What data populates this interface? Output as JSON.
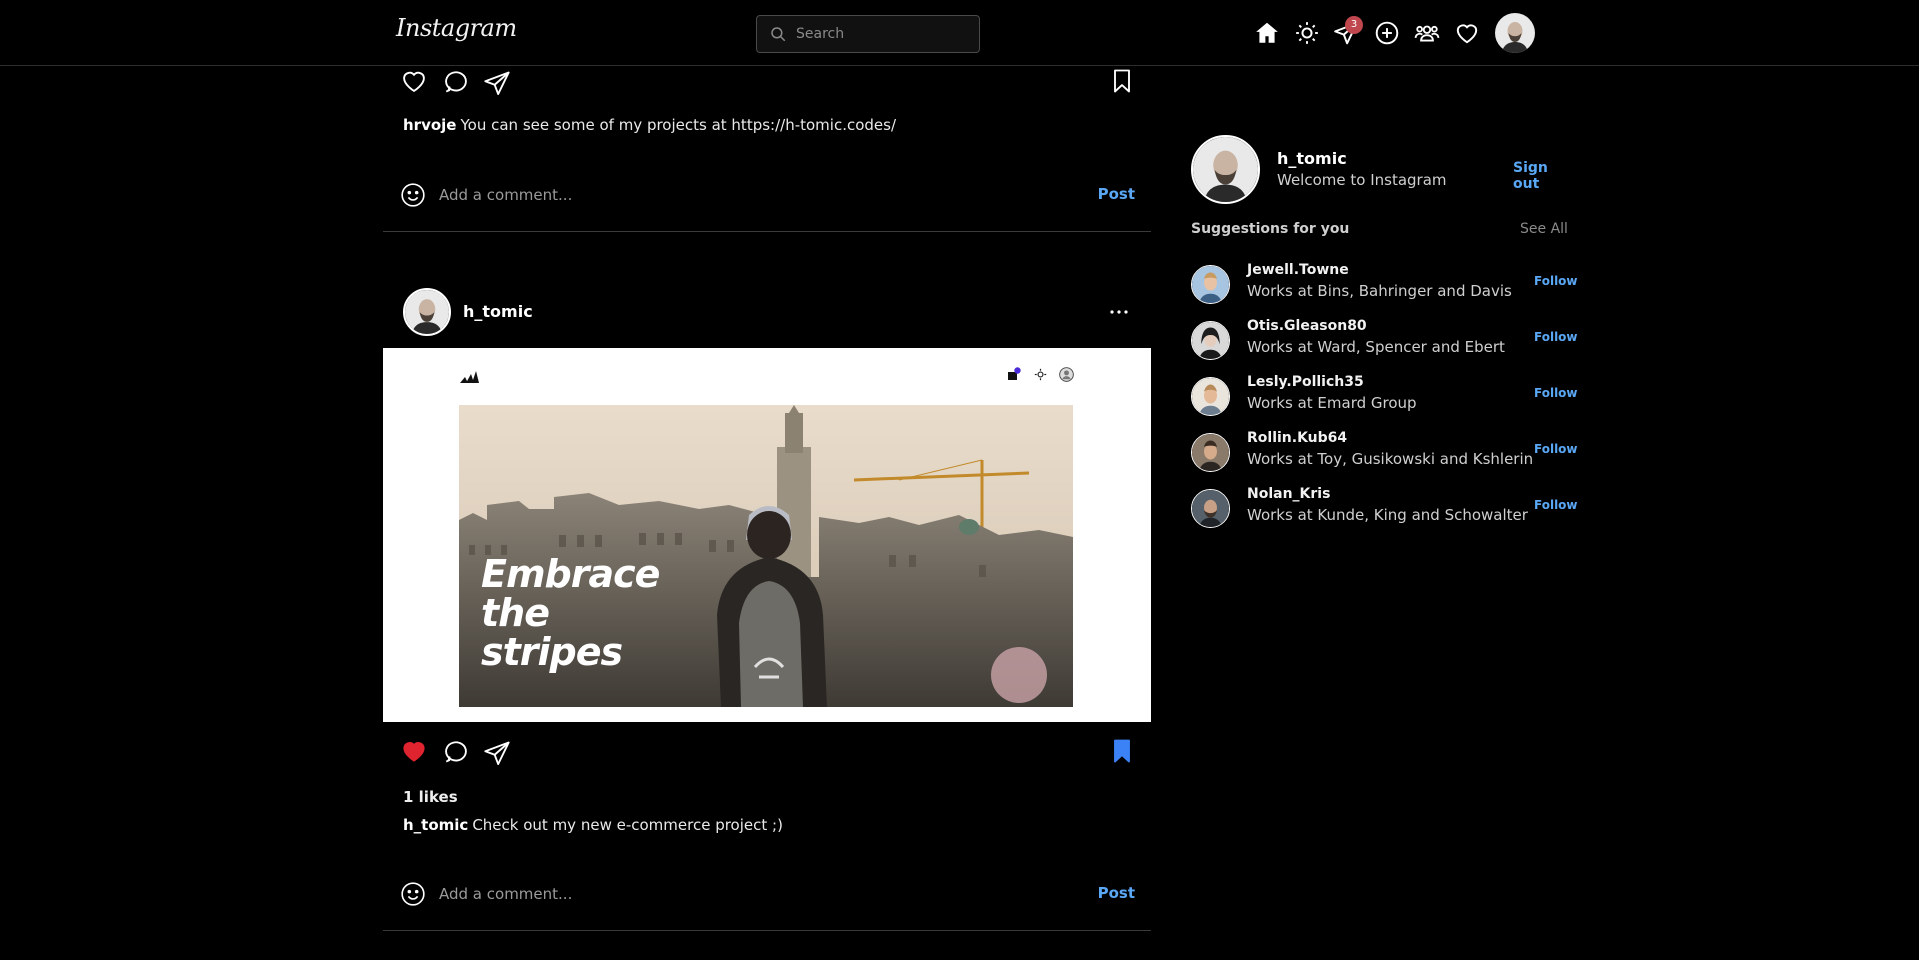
{
  "header": {
    "logo": "Instagram",
    "search_placeholder": "Search",
    "messages_badge": "3"
  },
  "feed": {
    "prev_post": {
      "caption_user": "hrvoje",
      "caption_text": "You can see some of my projects at https://h-tomic.codes/",
      "comment_placeholder": "Add a comment...",
      "post_label": "Post"
    },
    "post": {
      "username": "h_tomic",
      "image_headline": [
        "Embrace",
        "the",
        "stripes"
      ],
      "image_brand": "adidas",
      "liked": true,
      "saved": true,
      "likes": "1  likes",
      "caption_user": "h_tomic",
      "caption_text": "Check out my new e-commerce project ;)",
      "comment_placeholder": "Add a comment...",
      "post_label": "Post"
    }
  },
  "sidebar": {
    "username": "h_tomic",
    "welcome": "Welcome to Instagram",
    "sign_out": "Sign out",
    "suggestions_title": "Suggestions for you",
    "see_all": "See All",
    "suggestions": [
      {
        "username": "Jewell.Towne",
        "works": "Works at Bins, Bahringer and Davis",
        "follow": "Follow"
      },
      {
        "username": "Otis.Gleason80",
        "works": "Works at Ward, Spencer and Ebert",
        "follow": "Follow"
      },
      {
        "username": "Lesly.Pollich35",
        "works": "Works at Emard Group",
        "follow": "Follow"
      },
      {
        "username": "Rollin.Kub64",
        "works": "Works at Toy, Gusikowski and Kshlerin",
        "follow": "Follow"
      },
      {
        "username": "Nolan_Kris",
        "works": "Works at Kunde, King and Schowalter",
        "follow": "Follow"
      }
    ]
  },
  "colors": {
    "background": "#000000",
    "link_blue": "#5aa7f5",
    "like_red": "#e0242f",
    "save_blue": "#3b82f6",
    "badge_red": "#c0474e"
  }
}
